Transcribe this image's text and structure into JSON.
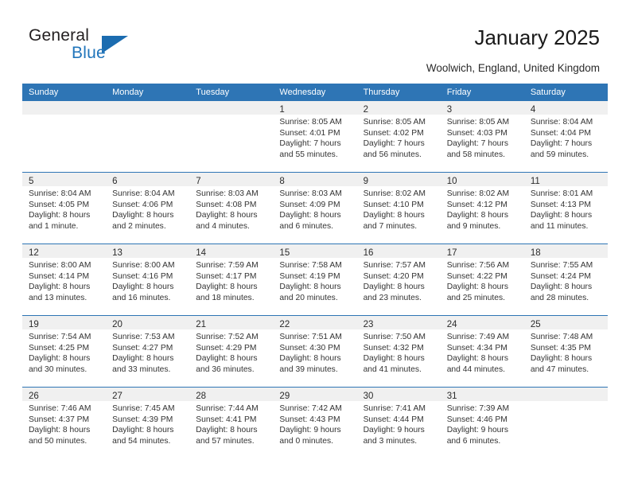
{
  "logo": {
    "primary_text": "General",
    "secondary_text": "Blue",
    "triangle_icon": "triangle-icon",
    "brand_color": "#2175bb"
  },
  "header": {
    "title": "January 2025",
    "subtitle": "Woolwich, England, United Kingdom"
  },
  "theme": {
    "header_blue": "#2e75b5",
    "daynum_strip": "#f0f0f0",
    "text": "#333333"
  },
  "calendar": {
    "weekday_headers": [
      "Sunday",
      "Monday",
      "Tuesday",
      "Wednesday",
      "Thursday",
      "Friday",
      "Saturday"
    ],
    "labels": {
      "sunrise_prefix": "Sunrise:",
      "sunset_prefix": "Sunset:",
      "daylight_prefix": "Daylight:"
    },
    "weeks": [
      [
        {
          "day": ""
        },
        {
          "day": ""
        },
        {
          "day": ""
        },
        {
          "day": "1",
          "sunrise": "Sunrise: 8:05 AM",
          "sunset": "Sunset: 4:01 PM",
          "daylight_line1": "Daylight: 7 hours",
          "daylight_line2": "and 55 minutes."
        },
        {
          "day": "2",
          "sunrise": "Sunrise: 8:05 AM",
          "sunset": "Sunset: 4:02 PM",
          "daylight_line1": "Daylight: 7 hours",
          "daylight_line2": "and 56 minutes."
        },
        {
          "day": "3",
          "sunrise": "Sunrise: 8:05 AM",
          "sunset": "Sunset: 4:03 PM",
          "daylight_line1": "Daylight: 7 hours",
          "daylight_line2": "and 58 minutes."
        },
        {
          "day": "4",
          "sunrise": "Sunrise: 8:04 AM",
          "sunset": "Sunset: 4:04 PM",
          "daylight_line1": "Daylight: 7 hours",
          "daylight_line2": "and 59 minutes."
        }
      ],
      [
        {
          "day": "5",
          "sunrise": "Sunrise: 8:04 AM",
          "sunset": "Sunset: 4:05 PM",
          "daylight_line1": "Daylight: 8 hours",
          "daylight_line2": "and 1 minute."
        },
        {
          "day": "6",
          "sunrise": "Sunrise: 8:04 AM",
          "sunset": "Sunset: 4:06 PM",
          "daylight_line1": "Daylight: 8 hours",
          "daylight_line2": "and 2 minutes."
        },
        {
          "day": "7",
          "sunrise": "Sunrise: 8:03 AM",
          "sunset": "Sunset: 4:08 PM",
          "daylight_line1": "Daylight: 8 hours",
          "daylight_line2": "and 4 minutes."
        },
        {
          "day": "8",
          "sunrise": "Sunrise: 8:03 AM",
          "sunset": "Sunset: 4:09 PM",
          "daylight_line1": "Daylight: 8 hours",
          "daylight_line2": "and 6 minutes."
        },
        {
          "day": "9",
          "sunrise": "Sunrise: 8:02 AM",
          "sunset": "Sunset: 4:10 PM",
          "daylight_line1": "Daylight: 8 hours",
          "daylight_line2": "and 7 minutes."
        },
        {
          "day": "10",
          "sunrise": "Sunrise: 8:02 AM",
          "sunset": "Sunset: 4:12 PM",
          "daylight_line1": "Daylight: 8 hours",
          "daylight_line2": "and 9 minutes."
        },
        {
          "day": "11",
          "sunrise": "Sunrise: 8:01 AM",
          "sunset": "Sunset: 4:13 PM",
          "daylight_line1": "Daylight: 8 hours",
          "daylight_line2": "and 11 minutes."
        }
      ],
      [
        {
          "day": "12",
          "sunrise": "Sunrise: 8:00 AM",
          "sunset": "Sunset: 4:14 PM",
          "daylight_line1": "Daylight: 8 hours",
          "daylight_line2": "and 13 minutes."
        },
        {
          "day": "13",
          "sunrise": "Sunrise: 8:00 AM",
          "sunset": "Sunset: 4:16 PM",
          "daylight_line1": "Daylight: 8 hours",
          "daylight_line2": "and 16 minutes."
        },
        {
          "day": "14",
          "sunrise": "Sunrise: 7:59 AM",
          "sunset": "Sunset: 4:17 PM",
          "daylight_line1": "Daylight: 8 hours",
          "daylight_line2": "and 18 minutes."
        },
        {
          "day": "15",
          "sunrise": "Sunrise: 7:58 AM",
          "sunset": "Sunset: 4:19 PM",
          "daylight_line1": "Daylight: 8 hours",
          "daylight_line2": "and 20 minutes."
        },
        {
          "day": "16",
          "sunrise": "Sunrise: 7:57 AM",
          "sunset": "Sunset: 4:20 PM",
          "daylight_line1": "Daylight: 8 hours",
          "daylight_line2": "and 23 minutes."
        },
        {
          "day": "17",
          "sunrise": "Sunrise: 7:56 AM",
          "sunset": "Sunset: 4:22 PM",
          "daylight_line1": "Daylight: 8 hours",
          "daylight_line2": "and 25 minutes."
        },
        {
          "day": "18",
          "sunrise": "Sunrise: 7:55 AM",
          "sunset": "Sunset: 4:24 PM",
          "daylight_line1": "Daylight: 8 hours",
          "daylight_line2": "and 28 minutes."
        }
      ],
      [
        {
          "day": "19",
          "sunrise": "Sunrise: 7:54 AM",
          "sunset": "Sunset: 4:25 PM",
          "daylight_line1": "Daylight: 8 hours",
          "daylight_line2": "and 30 minutes."
        },
        {
          "day": "20",
          "sunrise": "Sunrise: 7:53 AM",
          "sunset": "Sunset: 4:27 PM",
          "daylight_line1": "Daylight: 8 hours",
          "daylight_line2": "and 33 minutes."
        },
        {
          "day": "21",
          "sunrise": "Sunrise: 7:52 AM",
          "sunset": "Sunset: 4:29 PM",
          "daylight_line1": "Daylight: 8 hours",
          "daylight_line2": "and 36 minutes."
        },
        {
          "day": "22",
          "sunrise": "Sunrise: 7:51 AM",
          "sunset": "Sunset: 4:30 PM",
          "daylight_line1": "Daylight: 8 hours",
          "daylight_line2": "and 39 minutes."
        },
        {
          "day": "23",
          "sunrise": "Sunrise: 7:50 AM",
          "sunset": "Sunset: 4:32 PM",
          "daylight_line1": "Daylight: 8 hours",
          "daylight_line2": "and 41 minutes."
        },
        {
          "day": "24",
          "sunrise": "Sunrise: 7:49 AM",
          "sunset": "Sunset: 4:34 PM",
          "daylight_line1": "Daylight: 8 hours",
          "daylight_line2": "and 44 minutes."
        },
        {
          "day": "25",
          "sunrise": "Sunrise: 7:48 AM",
          "sunset": "Sunset: 4:35 PM",
          "daylight_line1": "Daylight: 8 hours",
          "daylight_line2": "and 47 minutes."
        }
      ],
      [
        {
          "day": "26",
          "sunrise": "Sunrise: 7:46 AM",
          "sunset": "Sunset: 4:37 PM",
          "daylight_line1": "Daylight: 8 hours",
          "daylight_line2": "and 50 minutes."
        },
        {
          "day": "27",
          "sunrise": "Sunrise: 7:45 AM",
          "sunset": "Sunset: 4:39 PM",
          "daylight_line1": "Daylight: 8 hours",
          "daylight_line2": "and 54 minutes."
        },
        {
          "day": "28",
          "sunrise": "Sunrise: 7:44 AM",
          "sunset": "Sunset: 4:41 PM",
          "daylight_line1": "Daylight: 8 hours",
          "daylight_line2": "and 57 minutes."
        },
        {
          "day": "29",
          "sunrise": "Sunrise: 7:42 AM",
          "sunset": "Sunset: 4:43 PM",
          "daylight_line1": "Daylight: 9 hours",
          "daylight_line2": "and 0 minutes."
        },
        {
          "day": "30",
          "sunrise": "Sunrise: 7:41 AM",
          "sunset": "Sunset: 4:44 PM",
          "daylight_line1": "Daylight: 9 hours",
          "daylight_line2": "and 3 minutes."
        },
        {
          "day": "31",
          "sunrise": "Sunrise: 7:39 AM",
          "sunset": "Sunset: 4:46 PM",
          "daylight_line1": "Daylight: 9 hours",
          "daylight_line2": "and 6 minutes."
        },
        {
          "day": ""
        }
      ]
    ]
  }
}
